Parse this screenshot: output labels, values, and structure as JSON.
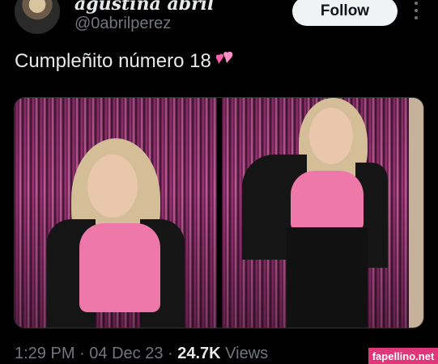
{
  "author": {
    "display_name": "agustina abril",
    "handle": "@0abrilperez"
  },
  "actions": {
    "follow_label": "Follow"
  },
  "tweet": {
    "text": "Cumpleñito número 18"
  },
  "meta": {
    "time": "1:29 PM",
    "date": "04 Dec 23",
    "views_count": "24.7K",
    "views_label": "Views"
  },
  "watermark": "fapellino.net",
  "colors": {
    "background": "#000000",
    "text": "#e7e9ea",
    "muted": "#71767b",
    "follow_bg": "#eff3f4",
    "watermark_bg": "#e0367a"
  }
}
